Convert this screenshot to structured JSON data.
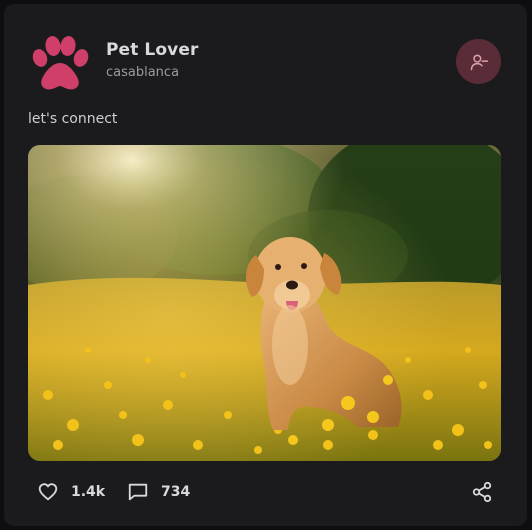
{
  "post": {
    "user": {
      "name": "Pet Lover",
      "handle": "casablanca",
      "avatar_icon": "paw-icon",
      "avatar_color": "#cf3f6a"
    },
    "caption": "let's connect",
    "image": "golden-retriever-in-flower-field",
    "actions": {
      "likes": "1.4k",
      "comments": "734",
      "like_icon": "heart-icon",
      "comment_icon": "comment-icon",
      "share_icon": "share-icon",
      "unfollow_icon": "user-minus-icon"
    }
  },
  "colors": {
    "background": "#0e0e10",
    "card": "#1b1b1d",
    "accent": "#cf3f6a",
    "accent_bg": "#5a2c38"
  }
}
